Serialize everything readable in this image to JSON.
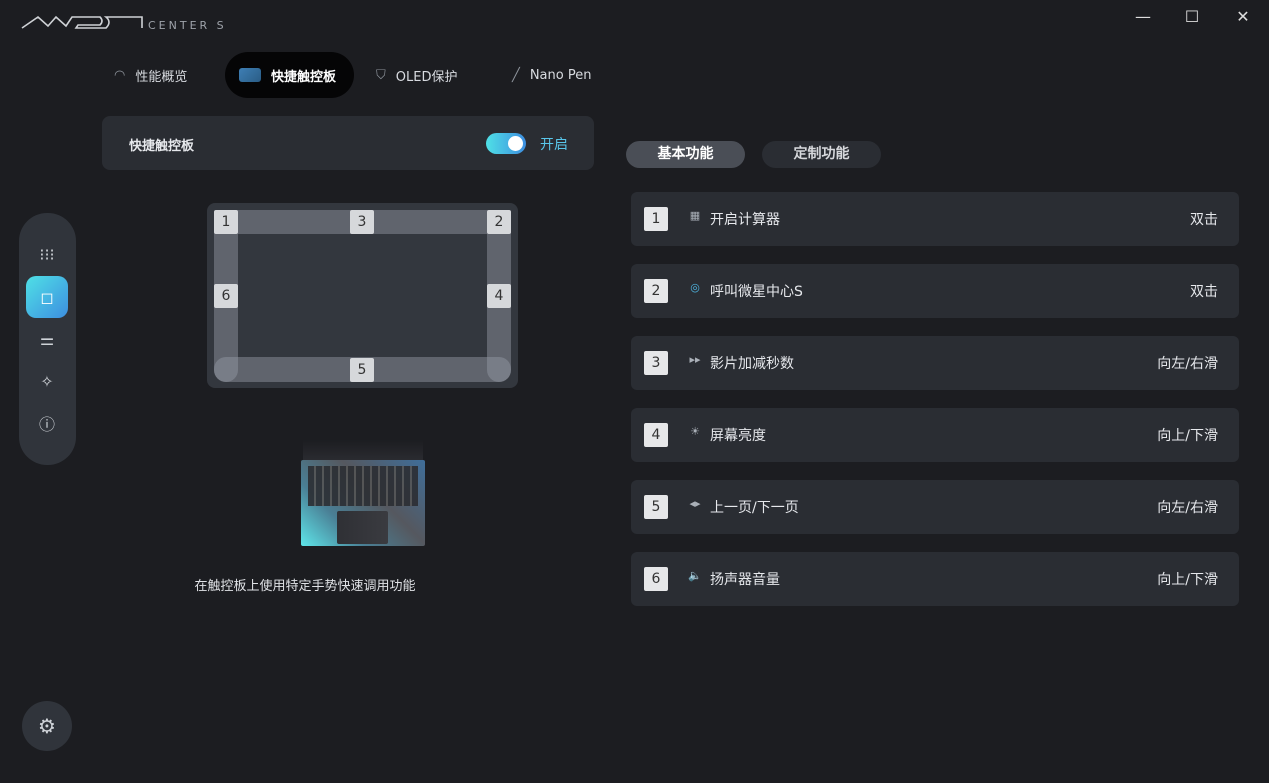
{
  "app": {
    "logo_text": "MSI CENTER S"
  },
  "window_controls": {
    "minimize": "—",
    "maximize": "☐",
    "close": "✕"
  },
  "tabs": [
    {
      "label": "性能概览",
      "icon": "speedometer-icon"
    },
    {
      "label": "快捷触控板",
      "icon": "touchpad-hand-icon",
      "active": true
    },
    {
      "label": "OLED保护",
      "icon": "shield-check-icon"
    },
    {
      "label": "Nano Pen",
      "icon": "pen-icon"
    }
  ],
  "feature_card": {
    "label": "快捷触控板",
    "toggle_on": true,
    "toggle_text": "开启"
  },
  "touchpad_zones": [
    "1",
    "2",
    "3",
    "4",
    "5",
    "6"
  ],
  "caption": "在触控板上使用特定手势快速调用功能",
  "segments": [
    {
      "label": "基本功能",
      "active": true
    },
    {
      "label": "定制功能"
    }
  ],
  "functions": [
    {
      "num": "1",
      "icon": "calculator-icon",
      "glyph": "▦",
      "name": "开启计算器",
      "gesture": "双击"
    },
    {
      "num": "2",
      "icon": "msi-center-icon",
      "glyph": "◎",
      "name": "呼叫微星中心S",
      "gesture": "双击"
    },
    {
      "num": "3",
      "icon": "fast-forward-icon",
      "glyph": "▸▸",
      "name": "影片加减秒数",
      "gesture": "向左/右滑"
    },
    {
      "num": "4",
      "icon": "brightness-icon",
      "glyph": "☀",
      "name": "屏幕亮度",
      "gesture": "向上/下滑"
    },
    {
      "num": "5",
      "icon": "page-nav-icon",
      "glyph": "◂▸",
      "name": "上一页/下一页",
      "gesture": "向左/右滑"
    },
    {
      "num": "6",
      "icon": "speaker-icon",
      "glyph": "🔈",
      "name": "扬声器音量",
      "gesture": "向上/下滑"
    }
  ],
  "colors": {
    "accent": "#4fb8e6",
    "bg": "#1c1d21",
    "card": "#2a2d33"
  }
}
